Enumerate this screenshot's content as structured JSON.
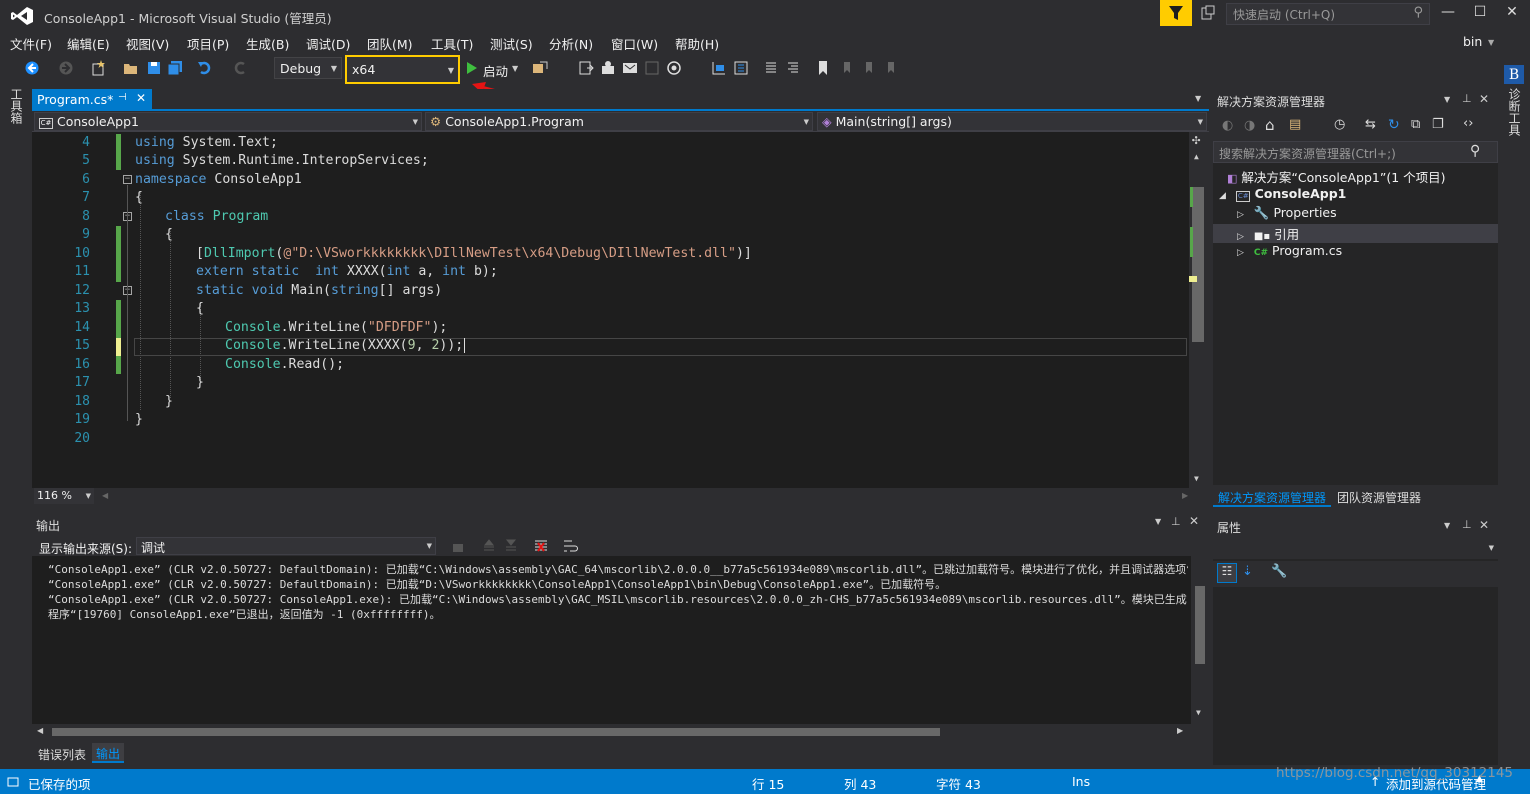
{
  "window": {
    "title": "ConsoleApp1 - Microsoft Visual Studio (管理员)",
    "quick_launch_placeholder": "快速启动 (Ctrl+Q)",
    "user": "bin",
    "user_badge": "B"
  },
  "menu": [
    "文件(F)",
    "编辑(E)",
    "视图(V)",
    "项目(P)",
    "生成(B)",
    "调试(D)",
    "团队(M)",
    "工具(T)",
    "测试(S)",
    "分析(N)",
    "窗口(W)",
    "帮助(H)"
  ],
  "toolbar": {
    "config": "Debug",
    "platform": "x64",
    "start_label": "启动"
  },
  "left_strip": {
    "toolbox": "工具箱"
  },
  "right_strip": {
    "diag": "诊断工具"
  },
  "editor": {
    "tab_label": "Program.cs*",
    "nav_project": "ConsoleApp1",
    "nav_class": "ConsoleApp1.Program",
    "nav_member": "Main(string[] args)",
    "zoom": "116 %",
    "line_numbers": [
      "4",
      "5",
      "6",
      "7",
      "8",
      "9",
      "10",
      "11",
      "12",
      "13",
      "14",
      "15",
      "16",
      "17",
      "18",
      "19",
      "20"
    ],
    "lines": {
      "l4a": "using",
      "l4b": " System.Text;",
      "l5a": "using",
      "l5b": " System.Runtime.InteropServices;",
      "l6a": "namespace",
      "l6b": " ConsoleApp1",
      "l7": "{",
      "l8a": "class",
      "l8b": " Program",
      "l9": "{",
      "l10a": "[",
      "l10b": "DllImport",
      "l10c": "(",
      "l10d": "@\"D:\\VSworkkkkkkkk\\DIllNewTest\\x64\\Debug\\DIllNewTest.dll\"",
      "l10e": ")]",
      "l11a": "extern static",
      "l11b": "int",
      "l11c": " XXXX(",
      "l11d": "int",
      "l11e": " a, ",
      "l11f": "int",
      "l11g": " b);",
      "l12a": "static void",
      "l12b": " Main(",
      "l12c": "string",
      "l12d": "[] args)",
      "l13": "{",
      "l14a": "Console",
      "l14b": ".WriteLine(",
      "l14c": "\"DFDFDF\"",
      "l14d": ");",
      "l15a": "Console",
      "l15b": ".WriteLine(XXXX(",
      "l15c": "9",
      "l15d": ", ",
      "l15e": "2",
      "l15f": "));",
      "l16a": "Console",
      "l16b": ".Read();",
      "l17": "}",
      "l18": "}",
      "l19": "}"
    }
  },
  "output": {
    "title": "输出",
    "source_label": "显示输出来源(S):",
    "source_value": "调试",
    "lines": [
      "“ConsoleApp1.exe” (CLR v2.0.50727: DefaultDomain): 已加载“C:\\Windows\\assembly\\GAC_64\\mscorlib\\2.0.0.0__b77a5c561934e089\\mscorlib.dll”。已跳过加载符号。模块进行了优化，并且调试器选项“仅我的",
      "“ConsoleApp1.exe” (CLR v2.0.50727: DefaultDomain): 已加载“D:\\VSworkkkkkkkk\\ConsoleApp1\\ConsoleApp1\\bin\\Debug\\ConsoleApp1.exe”。已加载符号。",
      "“ConsoleApp1.exe” (CLR v2.0.50727: ConsoleApp1.exe): 已加载“C:\\Windows\\assembly\\GAC_MSIL\\mscorlib.resources\\2.0.0.0_zh-CHS_b77a5c561934e089\\mscorlib.resources.dll”。模块已生成，不包含符号。",
      "程序“[19760] ConsoleApp1.exe”已退出，返回值为 -1 (0xffffffff)。"
    ],
    "tabs": [
      "错误列表",
      "输出"
    ]
  },
  "solution_explorer": {
    "title": "解决方案资源管理器",
    "search_placeholder": "搜索解决方案资源管理器(Ctrl+;)",
    "solution": "解决方案“ConsoleApp1”(1 个项目)",
    "project": "ConsoleApp1",
    "items": [
      "Properties",
      "引用",
      "Program.cs"
    ],
    "tabs": [
      "解决方案资源管理器",
      "团队资源管理器"
    ]
  },
  "properties": {
    "title": "属性"
  },
  "status": {
    "saved": "已保存的项",
    "line": "行 15",
    "col": "列 43",
    "ch": "字符 43",
    "ins": "Ins",
    "add_source": "添加到源代码管理",
    "watermark": "https://blog.csdn.net/qq_30312145"
  },
  "colors": {
    "accent": "#007acc",
    "highlight": "#ffcc00",
    "arrow": "#e51414"
  }
}
